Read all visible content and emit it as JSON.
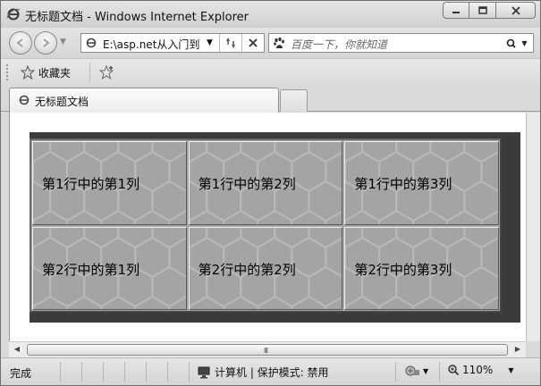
{
  "window": {
    "title": "无标题文档 - Windows Internet Explorer"
  },
  "navigation": {
    "address": "E:\\asp.net从入门到",
    "search_placeholder": "百度一下，你就知道"
  },
  "favorites_bar": {
    "favorites_label": "收藏夹"
  },
  "tabs": [
    {
      "title": "无标题文档"
    }
  ],
  "page_table": {
    "rows": [
      [
        "第1行中的第1列",
        "第1行中的第2列",
        "第1行中的第3列"
      ],
      [
        "第2行中的第1列",
        "第2行中的第2列",
        "第2行中的第3列"
      ]
    ]
  },
  "status_bar": {
    "status_text": "完成",
    "zone_text": "计算机 | 保护模式: 禁用",
    "zoom": "110%"
  },
  "colors": {
    "cell_background": "#a4a4a4",
    "shadow": "#3b3b3b"
  },
  "icons": [
    "ie-logo-icon",
    "minimize-icon",
    "maximize-icon",
    "close-icon",
    "back-icon",
    "forward-icon",
    "refresh-icon",
    "stop-icon",
    "baidu-paw-icon",
    "search-icon",
    "favorites-star-icon",
    "add-favorites-icon",
    "computer-icon",
    "security-icon",
    "zoom-icon"
  ]
}
